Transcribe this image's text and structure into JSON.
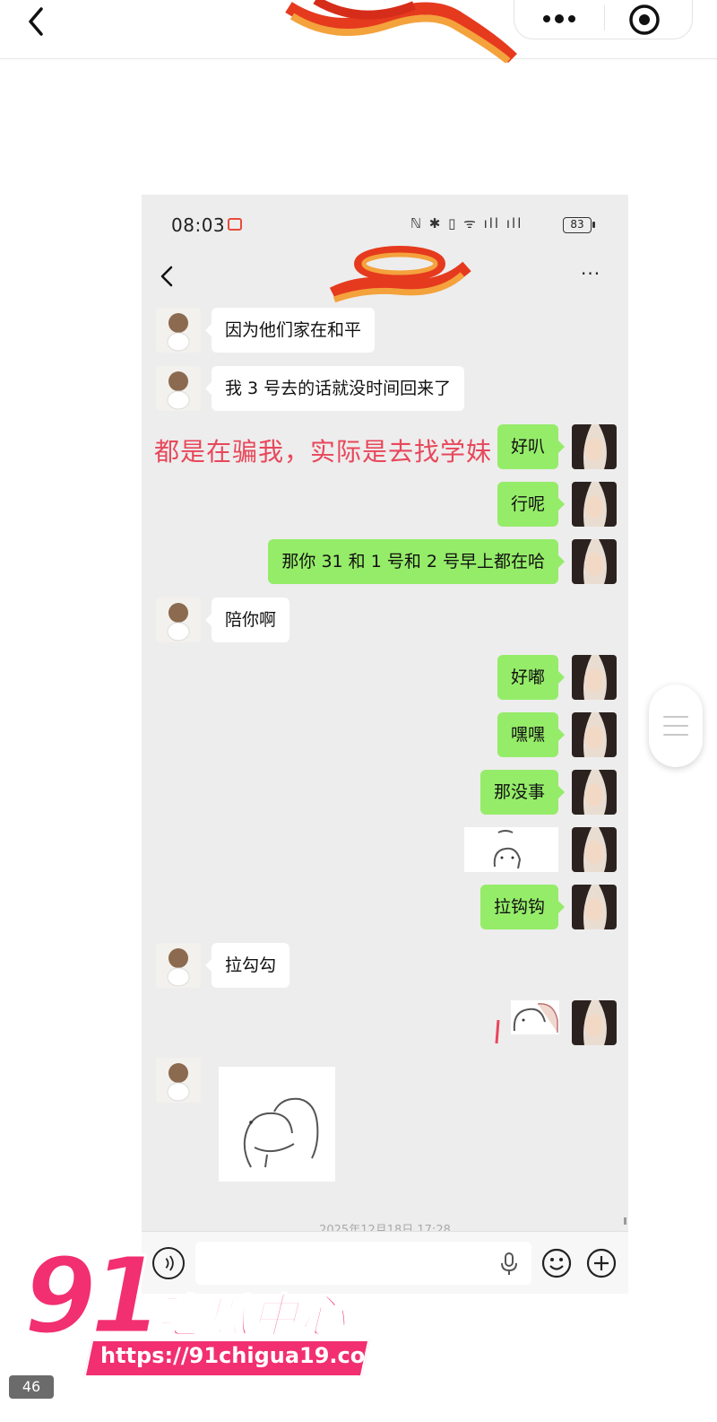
{
  "status_bar": {
    "time": "08:03",
    "icons_text": "ℕ ✱ ▯ ᯤ ıll ıll",
    "battery": "83"
  },
  "chat": {
    "more_label": "···",
    "messages": [
      {
        "side": "left",
        "type": "text",
        "text": "因为他们家在和平"
      },
      {
        "side": "left",
        "type": "text",
        "text": "我 3 号去的话就没时间回来了"
      },
      {
        "side": "right",
        "type": "text",
        "text": "好叭"
      },
      {
        "side": "right",
        "type": "text",
        "text": "行呢"
      },
      {
        "side": "right",
        "type": "text",
        "text": "那你 31 和 1 号和 2 号早上都在哈"
      },
      {
        "side": "left",
        "type": "text",
        "text": "陪你啊"
      },
      {
        "side": "right",
        "type": "text",
        "text": "好嘟"
      },
      {
        "side": "right",
        "type": "text",
        "text": "嘿嘿"
      },
      {
        "side": "right",
        "type": "text",
        "text": "那没事"
      },
      {
        "side": "right",
        "type": "sticker"
      },
      {
        "side": "right",
        "type": "text",
        "text": "拉钩钩"
      },
      {
        "side": "left",
        "type": "text",
        "text": "拉勾勾"
      },
      {
        "side": "right",
        "type": "sticker"
      },
      {
        "side": "left",
        "type": "sticker"
      }
    ],
    "timestamp": "2025年12月18日 17:28"
  },
  "overlay_annotation": "都是在骗我，实际是去找学妹",
  "watermark": {
    "number": "91",
    "name": "吃瓜中心",
    "url": "https://91chigua19.com"
  },
  "page_counter": "46",
  "colors": {
    "bubble_self": "#95ec69",
    "bubble_other": "#ffffff",
    "chat_bg": "#ededed",
    "annotation": "#e8475a",
    "watermark": "#f22f70"
  }
}
